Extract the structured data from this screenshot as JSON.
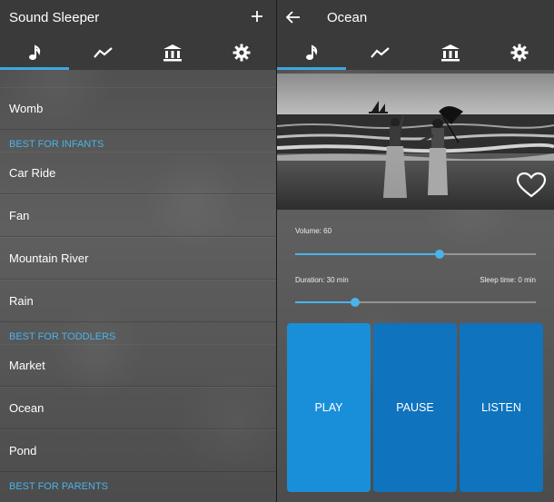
{
  "left": {
    "app_title": "Sound Sleeper",
    "tabs": [
      "music-note-icon",
      "trending-icon",
      "library-icon",
      "gear-icon"
    ],
    "list": [
      {
        "type": "item",
        "label": "Womb"
      },
      {
        "type": "section",
        "label": "BEST FOR INFANTS"
      },
      {
        "type": "item",
        "label": "Car Ride"
      },
      {
        "type": "item",
        "label": "Fan"
      },
      {
        "type": "item",
        "label": "Mountain River"
      },
      {
        "type": "item",
        "label": "Rain"
      },
      {
        "type": "section",
        "label": "BEST FOR TODDLERS"
      },
      {
        "type": "item",
        "label": "Market"
      },
      {
        "type": "item",
        "label": "Ocean"
      },
      {
        "type": "item",
        "label": "Pond"
      },
      {
        "type": "section",
        "label": "BEST FOR PARENTS"
      }
    ]
  },
  "right": {
    "screen_title": "Ocean",
    "volume_label": "Volume: 60",
    "volume_value": 0.6,
    "duration_label": "Duration: 30 min",
    "sleep_label": "Sleep time: 0 min",
    "duration_value": 0.25,
    "buttons": {
      "play": "PLAY",
      "pause": "PAUSE",
      "listen": "LISTEN"
    }
  },
  "colors": {
    "accent": "#4ab3ea",
    "play_bg": "#1a8fd9",
    "pause_bg": "#0f73bd",
    "listen_bg": "#0f73bd"
  }
}
